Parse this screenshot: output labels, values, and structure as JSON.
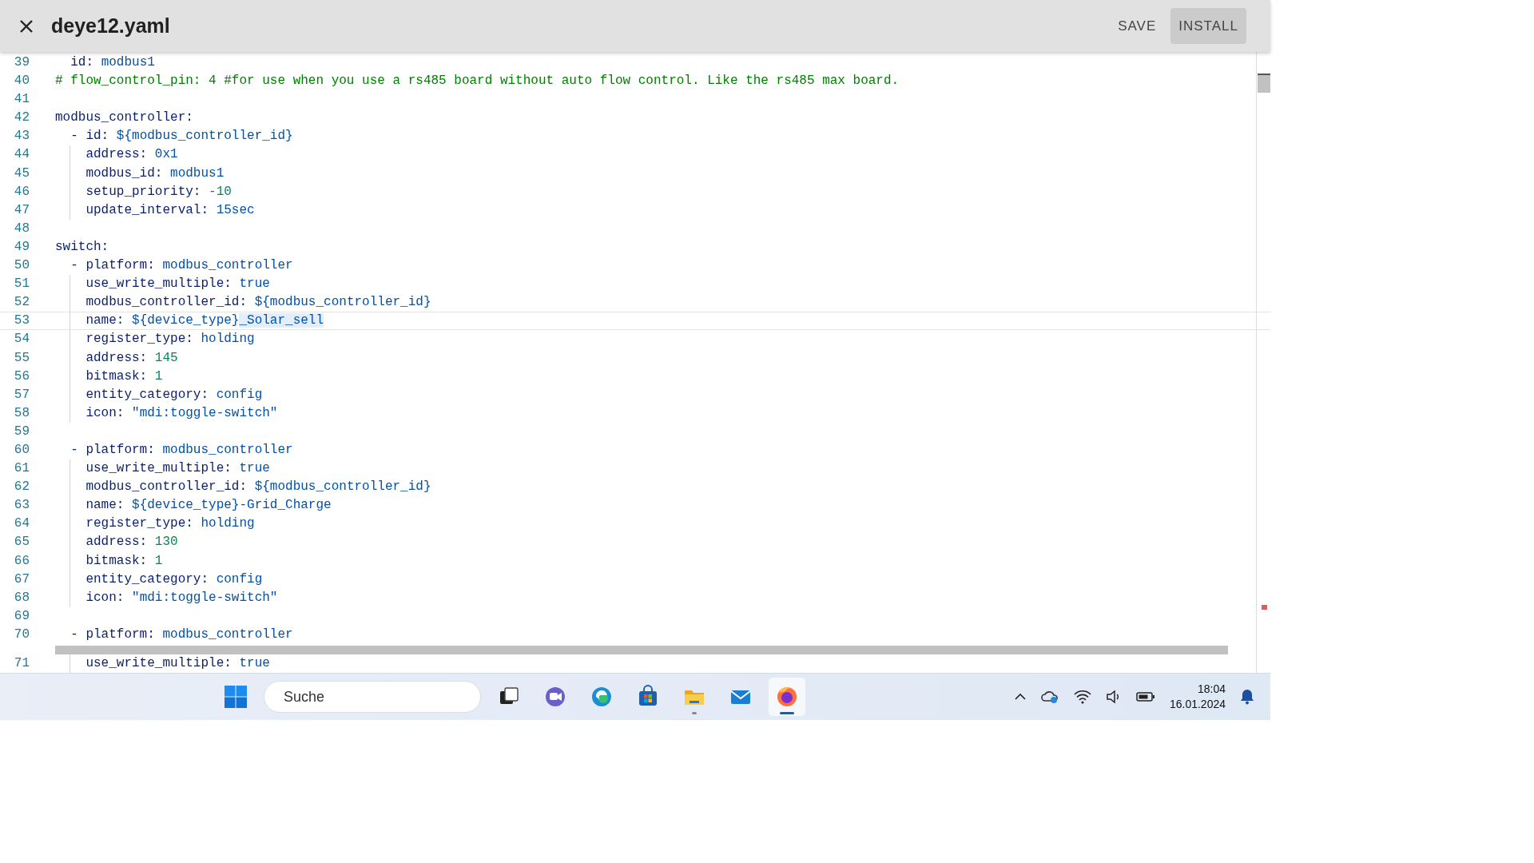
{
  "header": {
    "title": "deye12.yaml",
    "actions": [
      {
        "label": "SAVE",
        "selected": false
      },
      {
        "label": "INSTALL",
        "selected": true
      }
    ]
  },
  "editor": {
    "lines": [
      {
        "number": "39",
        "current": false,
        "parts": [
          {
            "kind": "key",
            "text": "  id:"
          },
          {
            "kind": "string",
            "text": " modbus1"
          }
        ]
      },
      {
        "number": "40",
        "current": false,
        "parts": [
          {
            "kind": "comment",
            "text": "# flow_control_pin: 4 #for use when you use a rs485 board without auto flow control. Like the rs485 max board."
          }
        ]
      },
      {
        "number": "41",
        "current": false
      },
      {
        "number": "42",
        "current": false,
        "parts": [
          {
            "kind": "key",
            "text": "modbus_controller:"
          }
        ]
      },
      {
        "number": "43",
        "current": false,
        "parts": [
          {
            "kind": "key",
            "text": "  - id:"
          },
          {
            "kind": "string",
            "text": " ${modbus_controller_id}"
          }
        ]
      },
      {
        "number": "44",
        "current": false,
        "parts": [
          {
            "kind": "key",
            "text": "    address:"
          },
          {
            "kind": "string",
            "text": " 0x1"
          }
        ]
      },
      {
        "number": "45",
        "current": false,
        "parts": [
          {
            "kind": "key",
            "text": "    modbus_id:"
          },
          {
            "kind": "string",
            "text": " modbus1"
          }
        ]
      },
      {
        "number": "46",
        "current": false,
        "parts": [
          {
            "kind": "key",
            "text": "    setup_priority:"
          },
          {
            "kind": "number",
            "text": " -10"
          }
        ]
      },
      {
        "number": "47",
        "current": false,
        "parts": [
          {
            "kind": "key",
            "text": "    update_interval:"
          },
          {
            "kind": "string",
            "text": " 15sec"
          }
        ]
      },
      {
        "number": "48",
        "current": false
      },
      {
        "number": "49",
        "current": false,
        "parts": [
          {
            "kind": "key",
            "text": "switch:"
          }
        ]
      },
      {
        "number": "50",
        "current": false,
        "parts": [
          {
            "kind": "key",
            "text": "  - platform:"
          },
          {
            "kind": "string",
            "text": " modbus_controller"
          }
        ]
      },
      {
        "number": "51",
        "current": false,
        "parts": [
          {
            "kind": "key",
            "text": "    use_write_multiple:"
          },
          {
            "kind": "bool",
            "text": " true"
          }
        ]
      },
      {
        "number": "52",
        "current": false,
        "parts": [
          {
            "kind": "key",
            "text": "    modbus_controller_id:"
          },
          {
            "kind": "string",
            "text": " ${modbus_controller_id}"
          }
        ]
      },
      {
        "number": "53",
        "current": true,
        "parts": [
          {
            "kind": "key",
            "text": "    name:"
          },
          {
            "kind": "string",
            "text": " ${device_type}"
          },
          {
            "kind": "match",
            "text": "_Solar_sell"
          }
        ]
      },
      {
        "number": "54",
        "current": false,
        "parts": [
          {
            "kind": "key",
            "text": "    register_type:"
          },
          {
            "kind": "string",
            "text": " holding"
          }
        ]
      },
      {
        "number": "55",
        "current": false,
        "parts": [
          {
            "kind": "key",
            "text": "    address:"
          },
          {
            "kind": "number",
            "text": " 145"
          }
        ]
      },
      {
        "number": "56",
        "current": false,
        "parts": [
          {
            "kind": "key",
            "text": "    bitmask:"
          },
          {
            "kind": "number",
            "text": " 1"
          }
        ]
      },
      {
        "number": "57",
        "current": false,
        "parts": [
          {
            "kind": "key",
            "text": "    entity_category:"
          },
          {
            "kind": "string",
            "text": " config"
          }
        ]
      },
      {
        "number": "58",
        "current": false,
        "parts": [
          {
            "kind": "key",
            "text": "    icon:"
          },
          {
            "kind": "string",
            "text": " \"mdi:toggle-switch\""
          }
        ]
      },
      {
        "number": "59",
        "current": false
      },
      {
        "number": "60",
        "current": false,
        "parts": [
          {
            "kind": "key",
            "text": "  - platform:"
          },
          {
            "kind": "string",
            "text": " modbus_controller"
          }
        ]
      },
      {
        "number": "61",
        "current": false,
        "parts": [
          {
            "kind": "key",
            "text": "    use_write_multiple:"
          },
          {
            "kind": "bool",
            "text": " true"
          }
        ]
      },
      {
        "number": "62",
        "current": false,
        "parts": [
          {
            "kind": "key",
            "text": "    modbus_controller_id:"
          },
          {
            "kind": "string",
            "text": " ${modbus_controller_id}"
          }
        ]
      },
      {
        "number": "63",
        "current": false,
        "parts": [
          {
            "kind": "key",
            "text": "    name:"
          },
          {
            "kind": "string",
            "text": " ${device_type}-Grid_Charge"
          }
        ]
      },
      {
        "number": "64",
        "current": false,
        "parts": [
          {
            "kind": "key",
            "text": "    register_type:"
          },
          {
            "kind": "string",
            "text": " holding"
          }
        ]
      },
      {
        "number": "65",
        "current": false,
        "parts": [
          {
            "kind": "key",
            "text": "    address:"
          },
          {
            "kind": "number",
            "text": " 130"
          }
        ]
      },
      {
        "number": "66",
        "current": false,
        "parts": [
          {
            "kind": "key",
            "text": "    bitmask:"
          },
          {
            "kind": "number",
            "text": " 1"
          }
        ]
      },
      {
        "number": "67",
        "current": false,
        "parts": [
          {
            "kind": "key",
            "text": "    entity_category:"
          },
          {
            "kind": "string",
            "text": " config"
          }
        ]
      },
      {
        "number": "68",
        "current": false,
        "parts": [
          {
            "kind": "key",
            "text": "    icon:"
          },
          {
            "kind": "string",
            "text": " \"mdi:toggle-switch\""
          }
        ]
      },
      {
        "number": "69",
        "current": false
      },
      {
        "number": "70",
        "current": false,
        "parts": [
          {
            "kind": "key",
            "text": "  - platform:"
          },
          {
            "kind": "string",
            "text": " modbus_controller"
          }
        ]
      },
      {
        "number": "71",
        "current": false,
        "parts": [
          {
            "kind": "key",
            "text": "    use_write_multiple:"
          },
          {
            "kind": "bool",
            "text": " true"
          }
        ]
      }
    ]
  },
  "taskbar": {
    "search": {
      "placeholder": "Suche"
    },
    "apps": [
      {
        "kind": "taskview",
        "running": false,
        "active": false
      },
      {
        "kind": "chat",
        "running": false,
        "active": false
      },
      {
        "kind": "edge",
        "running": false,
        "active": false
      },
      {
        "kind": "store",
        "running": false,
        "active": false
      },
      {
        "kind": "files",
        "running": true,
        "active": false
      },
      {
        "kind": "mail",
        "running": false,
        "active": false
      },
      {
        "kind": "firefox",
        "running": true,
        "active": true
      }
    ],
    "time": "18:04",
    "date": "16.01.2024"
  }
}
